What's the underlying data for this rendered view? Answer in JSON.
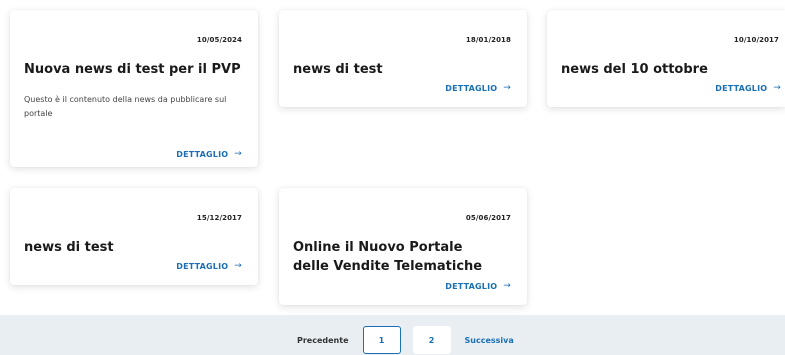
{
  "news": [
    {
      "date": "10/05/2024",
      "title": "Nuova news di test per il PVP",
      "body": "Questo è il contenuto della news da pubblicare sul portale",
      "link": "DETTAGLIO"
    },
    {
      "date": "18/01/2018",
      "title": "news di test",
      "link": "DETTAGLIO"
    },
    {
      "date": "10/10/2017",
      "title": "news del 10 ottobre",
      "link": "DETTAGLIO"
    },
    {
      "date": "15/12/2017",
      "title": "news di test",
      "link": "DETTAGLIO"
    },
    {
      "date": "05/06/2017",
      "title": "Online il Nuovo Portale delle Vendite Telematiche",
      "link": "DETTAGLIO"
    }
  ],
  "pagination": {
    "prev": "Precedente",
    "pages": [
      "1",
      "2"
    ],
    "current": "1",
    "next": "Successiva"
  },
  "icons": {
    "link_arrow": "arrow-right-icon"
  },
  "colors": {
    "accent": "#1a6fb5",
    "pager_bg": "#e8eef2"
  }
}
